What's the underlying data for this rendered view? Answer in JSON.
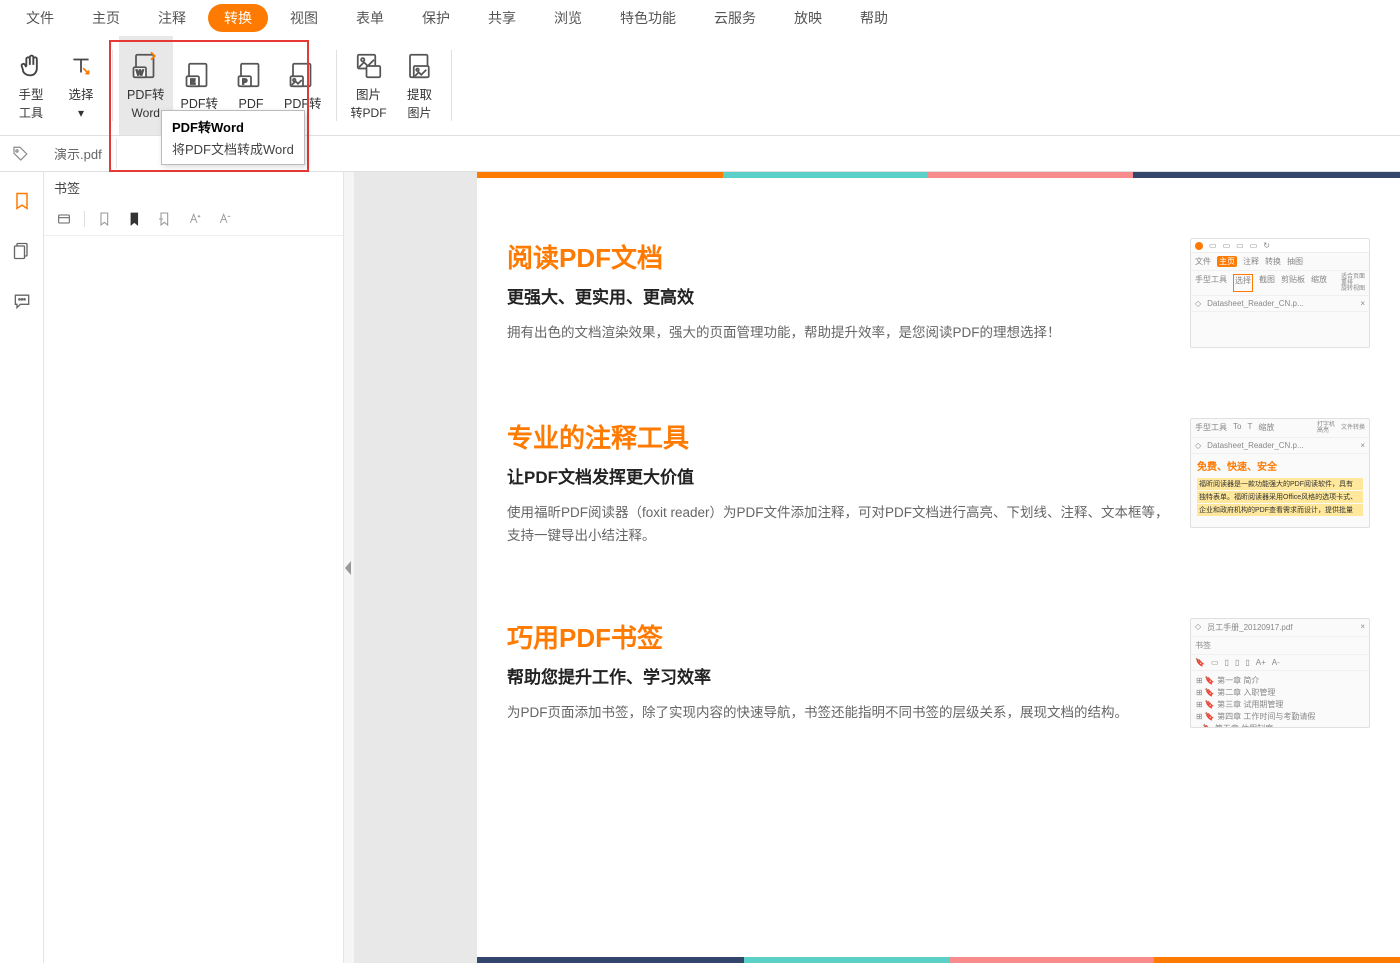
{
  "menubar": {
    "items": [
      "文件",
      "主页",
      "注释",
      "转换",
      "视图",
      "表单",
      "保护",
      "共享",
      "浏览",
      "特色功能",
      "云服务",
      "放映",
      "帮助"
    ],
    "active_index": 3
  },
  "ribbon": {
    "hand_tool": {
      "label1": "手型",
      "label2": "工具"
    },
    "select_tool": {
      "label1": "选择",
      "label2": "▾"
    },
    "pdf_word": {
      "label1": "PDF转",
      "label2": "Word"
    },
    "pdf_excel": {
      "label1": "PDF转",
      "label2": ""
    },
    "pdf_ppt": {
      "label1": "PDF",
      "label2": ""
    },
    "pdf_other": {
      "label1": "PDF转",
      "label2": ""
    },
    "img_pdf": {
      "label1": "图片",
      "label2": "转PDF"
    },
    "extract": {
      "label1": "提取",
      "label2": "图片"
    }
  },
  "tooltip": {
    "title": "PDF转Word",
    "desc": "将PDF文档转成Word"
  },
  "tab": {
    "name": "演示.pdf"
  },
  "bookmarks": {
    "title": "书签"
  },
  "content": {
    "feature1": {
      "title": "阅读PDF文档",
      "sub": "更强大、更实用、更高效",
      "desc": "拥有出色的文档渲染效果，强大的页面管理功能，帮助提升效率，是您阅读PDF的理想选择！",
      "mini_tabs": [
        "文件",
        "主页",
        "注释",
        "转换",
        "抽图"
      ],
      "mini_items": [
        "手型工具",
        "选择",
        "截图",
        "剪贴板",
        "缩放"
      ],
      "mini_side": [
        "适合页面",
        "重排",
        "旋转视图"
      ],
      "mini_file": "Datasheet_Reader_CN.p..."
    },
    "feature2": {
      "title": "专业的注释工具",
      "sub": "让PDF文档发挥更大价值",
      "desc": "使用福昕PDF阅读器（foxit reader）为PDF文件添加注释，可对PDF文档进行高亮、下划线、注释、文本框等，支持一键导出小结注释。",
      "mini_items": [
        "手型工具",
        "",
        "缩放"
      ],
      "mini_side": [
        "打字机",
        "高亮",
        "文件转换"
      ],
      "mini_file": "Datasheet_Reader_CN.p...",
      "mini_headline": "免费、快速、安全",
      "mini_hl": [
        "福昕阅读器是一款功能强大的PDF阅读软件，具有",
        "独特表单。福昕阅读器采用Office风格的选项卡式、",
        "企业和政府机构的PDF查看需求而设计，提供批量"
      ]
    },
    "feature3": {
      "title": "巧用PDF书签",
      "sub": "帮助您提升工作、学习效率",
      "desc": "为PDF页面添加书签，除了实现内容的快速导航，书签还能指明不同书签的层级关系，展现文档的结构。",
      "mini_file": "员工手册_20120917.pdf",
      "mini_panel_title": "书签",
      "mini_bookmarks": [
        "第一章  简介",
        "第二章  入职管理",
        "第三章  试用期管理",
        "第四章  工作时间与考勤请假",
        "第五章  休假制度"
      ]
    }
  }
}
